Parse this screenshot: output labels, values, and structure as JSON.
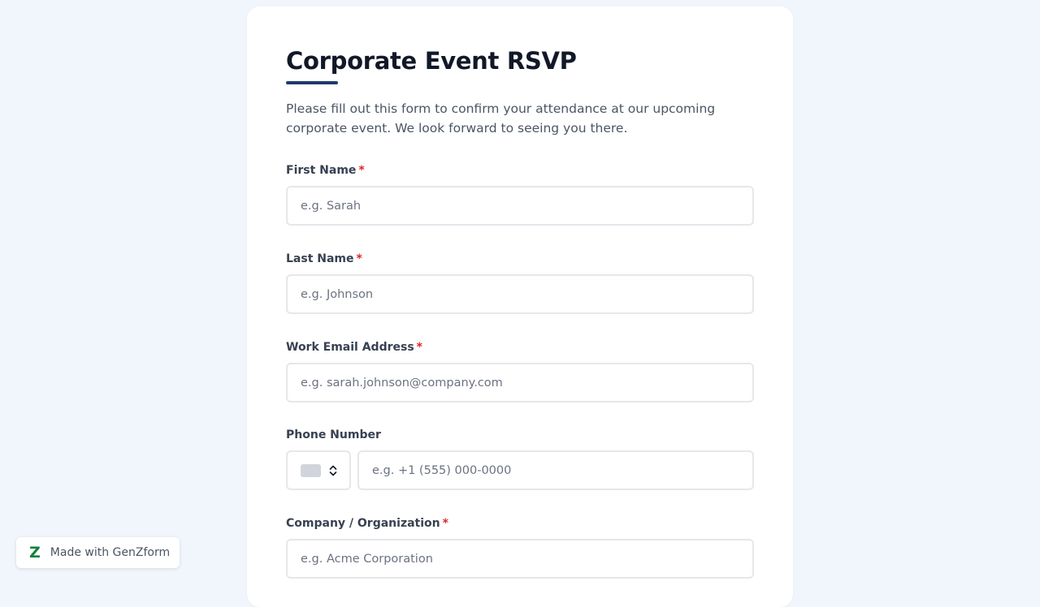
{
  "form": {
    "title": "Corporate Event RSVP",
    "intro": "Please fill out this form to confirm your attendance at our upcoming corporate event. We look forward to seeing you there.",
    "required_mark": "*",
    "fields": {
      "first_name": {
        "label": "First Name",
        "placeholder": "e.g. Sarah",
        "required": true
      },
      "last_name": {
        "label": "Last Name",
        "placeholder": "e.g. Johnson",
        "required": true
      },
      "email": {
        "label": "Work Email Address",
        "placeholder": "e.g. sarah.johnson@company.com",
        "required": true
      },
      "phone": {
        "label": "Phone Number",
        "placeholder": "e.g. +1 (555) 000-0000",
        "required": false,
        "country_icon": "flag-placeholder-icon"
      },
      "company": {
        "label": "Company / Organization",
        "placeholder": "e.g. Acme Corporation",
        "required": true
      }
    }
  },
  "badge": {
    "logo": "Z",
    "text": "Made with GenZform"
  },
  "colors": {
    "background": "#f1f5fc",
    "accent": "#1e3a6e",
    "required": "#dc2626",
    "brand": "#15803d"
  }
}
